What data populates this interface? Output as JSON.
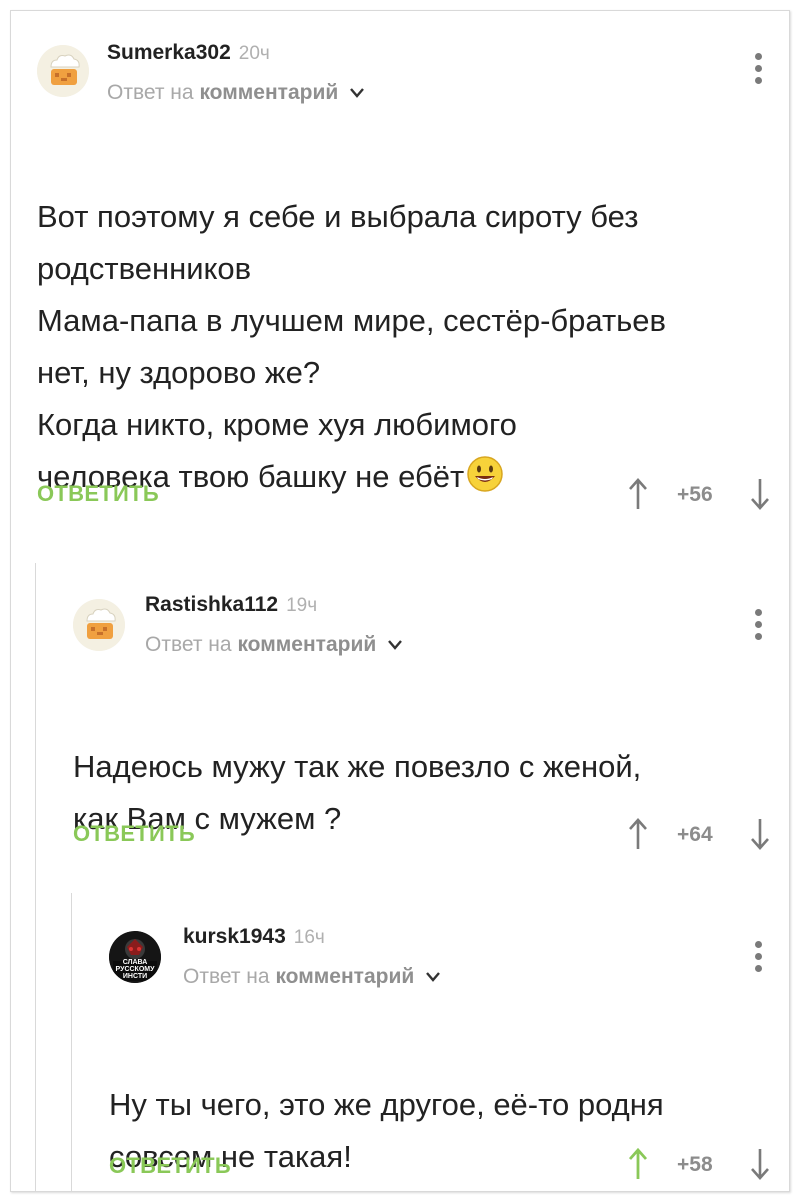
{
  "comments": [
    {
      "username": "Sumerka302",
      "time": "20ч",
      "reply_prefix": "Ответ на",
      "reply_target": "комментарий",
      "text": "Вот поэтому я себе и выбрала сироту без\nродственников\nМама-папа в лучшем мире, сестёр-братьев\nнет,  ну здорово же?\nКогда никто, кроме хуя любимого\nчеловека твою башку не ебёт",
      "emoji": "smiling-face-icon",
      "reply_label": "ОТВЕТИТЬ",
      "score": "+56",
      "upvoted": false
    },
    {
      "username": "Rastishka112",
      "time": "19ч",
      "reply_prefix": "Ответ на",
      "reply_target": "комментарий",
      "text": "Надеюсь мужу так же повезло с женой,\nкак Вам с мужем ?",
      "reply_label": "ОТВЕТИТЬ",
      "score": "+64",
      "upvoted": false
    },
    {
      "username": "kursk1943",
      "time": "16ч",
      "reply_prefix": "Ответ на",
      "reply_target": "комментарий",
      "text": "Ну ты чего, это же другое, её-то родня\nсовсем не такая!",
      "reply_label": "ОТВЕТИТЬ",
      "score": "+58",
      "upvoted": true,
      "avatar_text": "СЛАВА\nРУССКОМУ\nИНСТИ"
    }
  ],
  "colors": {
    "reply_green": "#8ac858",
    "upvote_active": "#8ac858",
    "vote_gray": "#7a7a7a"
  }
}
